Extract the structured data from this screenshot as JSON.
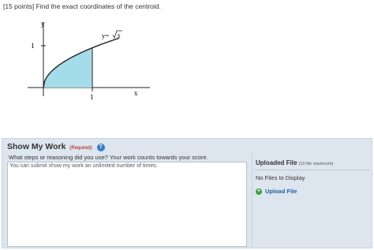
{
  "question": {
    "text": "[15 points] Find the exact coordinates of the centroid."
  },
  "figure": {
    "y_axis_label": "y",
    "x_axis_label": "x",
    "y_tick_label": "1",
    "x_tick_label": "1",
    "curve_label": "y=",
    "sqrt_argument": "x",
    "region_fill_color": "#a5dcea",
    "region_stroke_color": "#222222"
  },
  "show_my_work": {
    "title": "Show My Work",
    "required_label": "(Required)",
    "help_icon": "?",
    "prompt": "What steps or reasoning did you use? Your work counts towards your score.",
    "work_placeholder": "You can submit show my work an unlimited number of times."
  },
  "uploaded_file": {
    "title": "Uploaded File",
    "max_note": "(10 file maximum)",
    "no_files_text": "No Files to Display",
    "upload_button_label": "Upload File",
    "upload_icon": "plus-circle-icon"
  },
  "colors": {
    "panel_bg": "#dde6ef",
    "link_blue": "#1f5fa8",
    "help_blue": "#3a7bc8",
    "required_red": "#b00000",
    "plus_green": "#3aa13a"
  }
}
